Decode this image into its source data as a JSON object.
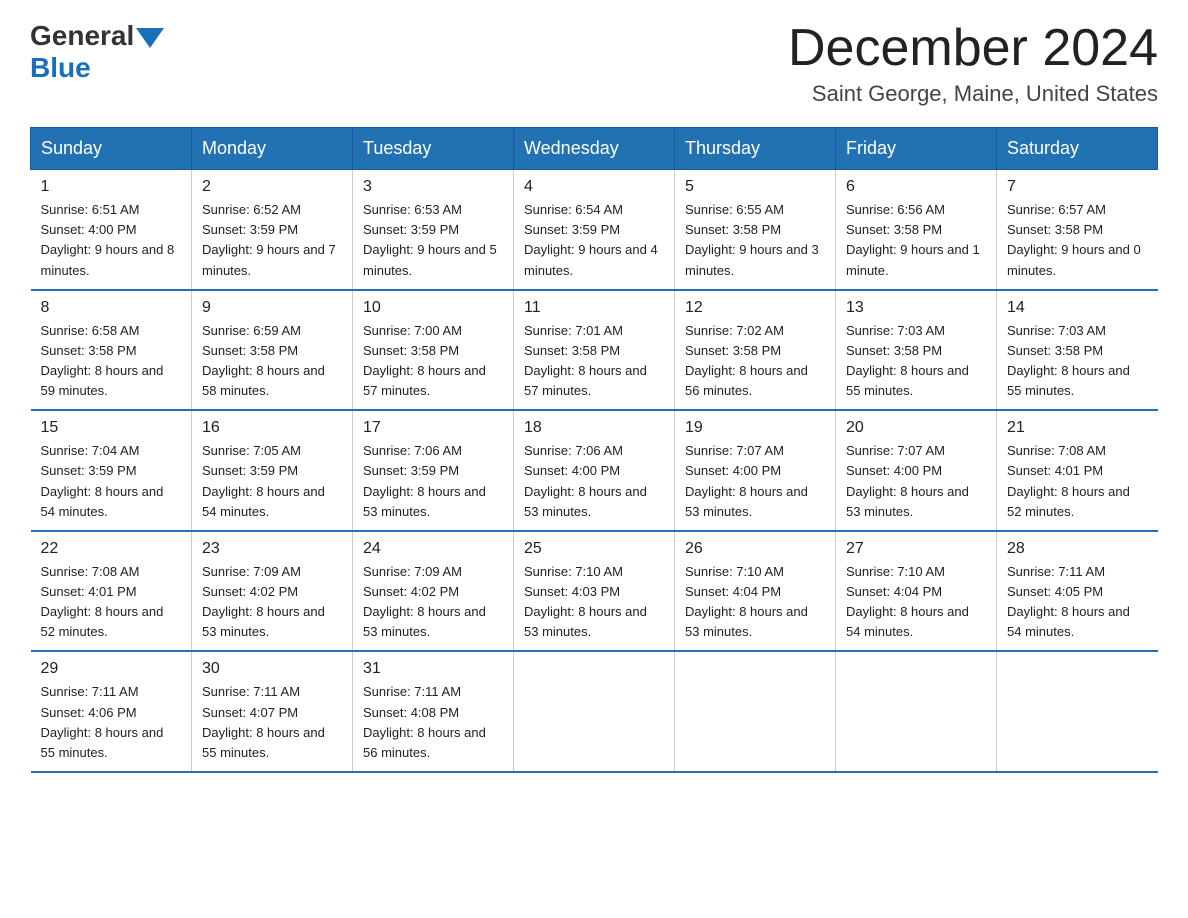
{
  "header": {
    "logo_general": "General",
    "logo_blue": "Blue",
    "month_title": "December 2024",
    "location": "Saint George, Maine, United States"
  },
  "weekdays": [
    "Sunday",
    "Monday",
    "Tuesday",
    "Wednesday",
    "Thursday",
    "Friday",
    "Saturday"
  ],
  "weeks": [
    [
      {
        "day": "1",
        "sunrise": "6:51 AM",
        "sunset": "4:00 PM",
        "daylight": "9 hours and 8 minutes."
      },
      {
        "day": "2",
        "sunrise": "6:52 AM",
        "sunset": "3:59 PM",
        "daylight": "9 hours and 7 minutes."
      },
      {
        "day": "3",
        "sunrise": "6:53 AM",
        "sunset": "3:59 PM",
        "daylight": "9 hours and 5 minutes."
      },
      {
        "day": "4",
        "sunrise": "6:54 AM",
        "sunset": "3:59 PM",
        "daylight": "9 hours and 4 minutes."
      },
      {
        "day": "5",
        "sunrise": "6:55 AM",
        "sunset": "3:58 PM",
        "daylight": "9 hours and 3 minutes."
      },
      {
        "day": "6",
        "sunrise": "6:56 AM",
        "sunset": "3:58 PM",
        "daylight": "9 hours and 1 minute."
      },
      {
        "day": "7",
        "sunrise": "6:57 AM",
        "sunset": "3:58 PM",
        "daylight": "9 hours and 0 minutes."
      }
    ],
    [
      {
        "day": "8",
        "sunrise": "6:58 AM",
        "sunset": "3:58 PM",
        "daylight": "8 hours and 59 minutes."
      },
      {
        "day": "9",
        "sunrise": "6:59 AM",
        "sunset": "3:58 PM",
        "daylight": "8 hours and 58 minutes."
      },
      {
        "day": "10",
        "sunrise": "7:00 AM",
        "sunset": "3:58 PM",
        "daylight": "8 hours and 57 minutes."
      },
      {
        "day": "11",
        "sunrise": "7:01 AM",
        "sunset": "3:58 PM",
        "daylight": "8 hours and 57 minutes."
      },
      {
        "day": "12",
        "sunrise": "7:02 AM",
        "sunset": "3:58 PM",
        "daylight": "8 hours and 56 minutes."
      },
      {
        "day": "13",
        "sunrise": "7:03 AM",
        "sunset": "3:58 PM",
        "daylight": "8 hours and 55 minutes."
      },
      {
        "day": "14",
        "sunrise": "7:03 AM",
        "sunset": "3:58 PM",
        "daylight": "8 hours and 55 minutes."
      }
    ],
    [
      {
        "day": "15",
        "sunrise": "7:04 AM",
        "sunset": "3:59 PM",
        "daylight": "8 hours and 54 minutes."
      },
      {
        "day": "16",
        "sunrise": "7:05 AM",
        "sunset": "3:59 PM",
        "daylight": "8 hours and 54 minutes."
      },
      {
        "day": "17",
        "sunrise": "7:06 AM",
        "sunset": "3:59 PM",
        "daylight": "8 hours and 53 minutes."
      },
      {
        "day": "18",
        "sunrise": "7:06 AM",
        "sunset": "4:00 PM",
        "daylight": "8 hours and 53 minutes."
      },
      {
        "day": "19",
        "sunrise": "7:07 AM",
        "sunset": "4:00 PM",
        "daylight": "8 hours and 53 minutes."
      },
      {
        "day": "20",
        "sunrise": "7:07 AM",
        "sunset": "4:00 PM",
        "daylight": "8 hours and 53 minutes."
      },
      {
        "day": "21",
        "sunrise": "7:08 AM",
        "sunset": "4:01 PM",
        "daylight": "8 hours and 52 minutes."
      }
    ],
    [
      {
        "day": "22",
        "sunrise": "7:08 AM",
        "sunset": "4:01 PM",
        "daylight": "8 hours and 52 minutes."
      },
      {
        "day": "23",
        "sunrise": "7:09 AM",
        "sunset": "4:02 PM",
        "daylight": "8 hours and 53 minutes."
      },
      {
        "day": "24",
        "sunrise": "7:09 AM",
        "sunset": "4:02 PM",
        "daylight": "8 hours and 53 minutes."
      },
      {
        "day": "25",
        "sunrise": "7:10 AM",
        "sunset": "4:03 PM",
        "daylight": "8 hours and 53 minutes."
      },
      {
        "day": "26",
        "sunrise": "7:10 AM",
        "sunset": "4:04 PM",
        "daylight": "8 hours and 53 minutes."
      },
      {
        "day": "27",
        "sunrise": "7:10 AM",
        "sunset": "4:04 PM",
        "daylight": "8 hours and 54 minutes."
      },
      {
        "day": "28",
        "sunrise": "7:11 AM",
        "sunset": "4:05 PM",
        "daylight": "8 hours and 54 minutes."
      }
    ],
    [
      {
        "day": "29",
        "sunrise": "7:11 AM",
        "sunset": "4:06 PM",
        "daylight": "8 hours and 55 minutes."
      },
      {
        "day": "30",
        "sunrise": "7:11 AM",
        "sunset": "4:07 PM",
        "daylight": "8 hours and 55 minutes."
      },
      {
        "day": "31",
        "sunrise": "7:11 AM",
        "sunset": "4:08 PM",
        "daylight": "8 hours and 56 minutes."
      },
      null,
      null,
      null,
      null
    ]
  ],
  "labels": {
    "sunrise": "Sunrise:",
    "sunset": "Sunset:",
    "daylight": "Daylight:"
  }
}
